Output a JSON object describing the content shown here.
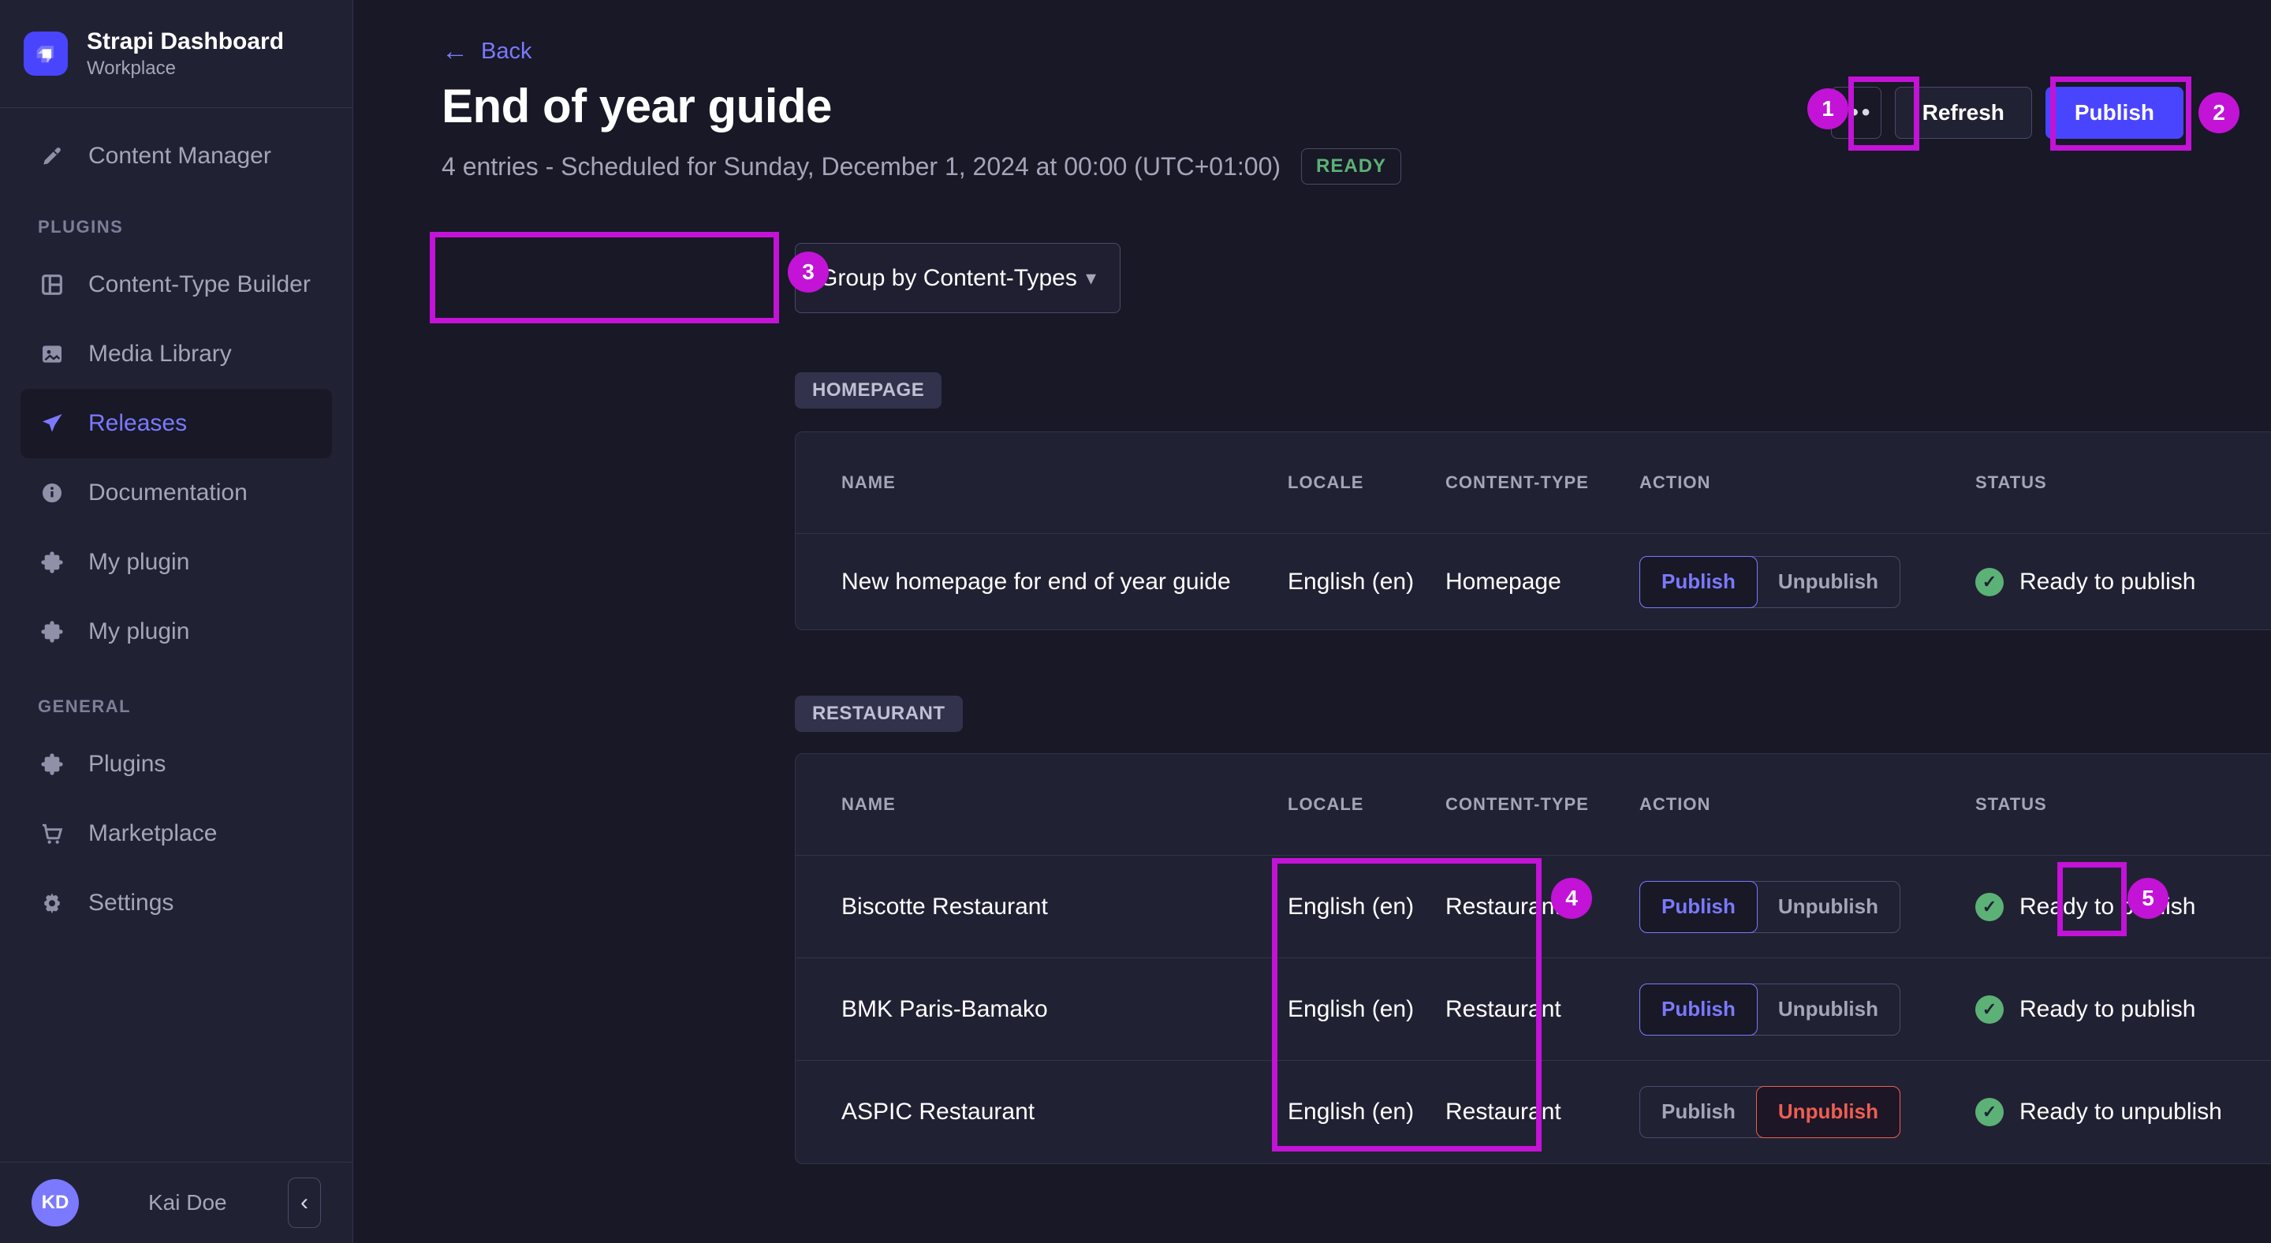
{
  "sidebar": {
    "logo": {
      "title": "Strapi Dashboard",
      "subtitle": "Workplace"
    },
    "nav_top": [
      {
        "label": "Content Manager",
        "icon": "pencil-icon"
      }
    ],
    "sections": [
      {
        "header": "PLUGINS",
        "items": [
          {
            "label": "Content-Type Builder",
            "icon": "layout-icon",
            "active": false
          },
          {
            "label": "Media Library",
            "icon": "image-icon",
            "active": false
          },
          {
            "label": "Releases",
            "icon": "paper-plane-icon",
            "active": true
          },
          {
            "label": "Documentation",
            "icon": "info-icon",
            "active": false
          },
          {
            "label": "My plugin",
            "icon": "puzzle-icon",
            "active": false
          },
          {
            "label": "My plugin",
            "icon": "puzzle-icon",
            "active": false
          }
        ]
      },
      {
        "header": "GENERAL",
        "items": [
          {
            "label": "Plugins",
            "icon": "puzzle-icon",
            "active": false
          },
          {
            "label": "Marketplace",
            "icon": "cart-icon",
            "active": false
          },
          {
            "label": "Settings",
            "icon": "gear-icon",
            "active": false
          }
        ]
      }
    ],
    "user": {
      "initials": "KD",
      "name": "Kai Doe"
    }
  },
  "header": {
    "back": "Back",
    "title": "End of year guide",
    "subtitle": "4 entries - Scheduled for Sunday, December 1, 2024 at 00:00 (UTC+01:00)",
    "status_badge": "READY",
    "refresh_label": "Refresh",
    "publish_label": "Publish"
  },
  "toolbar": {
    "group_by": "Group by Content-Types"
  },
  "action_labels": {
    "publish": "Publish",
    "unpublish": "Unpublish"
  },
  "sections": [
    {
      "badge": "HOMEPAGE",
      "columns": [
        "NAME",
        "LOCALE",
        "CONTENT-TYPE",
        "ACTION",
        "STATUS"
      ],
      "rows": [
        {
          "name": "New homepage for end of year guide",
          "locale": "English (en)",
          "content_type": "Homepage",
          "selected_action": "publish",
          "status": "Ready to publish"
        }
      ]
    },
    {
      "badge": "RESTAURANT",
      "columns": [
        "NAME",
        "LOCALE",
        "CONTENT-TYPE",
        "ACTION",
        "STATUS"
      ],
      "rows": [
        {
          "name": "Biscotte Restaurant",
          "locale": "English (en)",
          "content_type": "Restaurant",
          "selected_action": "publish",
          "status": "Ready to publish"
        },
        {
          "name": "BMK Paris-Bamako",
          "locale": "English (en)",
          "content_type": "Restaurant",
          "selected_action": "publish",
          "status": "Ready to publish"
        },
        {
          "name": "ASPIC Restaurant",
          "locale": "English (en)",
          "content_type": "Restaurant",
          "selected_action": "unpublish",
          "status": "Ready to unpublish"
        }
      ]
    }
  ],
  "annotations": {
    "numbers": [
      "1",
      "2",
      "3",
      "4",
      "5"
    ],
    "color": "#c213d6"
  },
  "icons": {
    "back_arrow": "←",
    "caret_down": "▾",
    "ellipsis": "•••",
    "check": "✓",
    "collapse": "‹",
    "help": "?"
  },
  "colors": {
    "accent": "#4945ff",
    "accent_light": "#7b79ff",
    "success": "#5cb176",
    "danger": "#ee5e52",
    "background": "#181826",
    "panel": "#212134"
  }
}
